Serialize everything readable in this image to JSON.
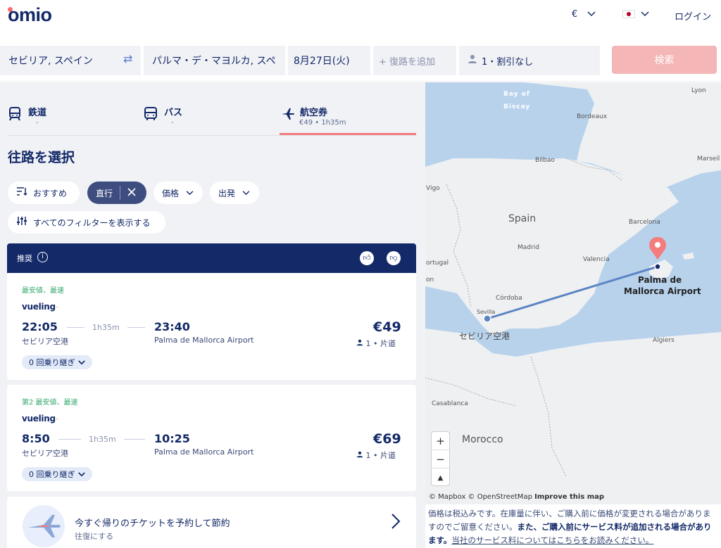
{
  "header": {
    "logo": "omio",
    "currency": "€",
    "login": "ログイン"
  },
  "search": {
    "from": "セビリア, スペイン",
    "to": "パルマ・デ・マヨルカ, スペ",
    "date": "8月27日(火)",
    "return_placeholder": "+ 復路を追加",
    "passengers": "1・割引なし",
    "submit": "検索"
  },
  "tabs": [
    {
      "icon": "train-icon",
      "label": "鉄道",
      "sub": "-"
    },
    {
      "icon": "bus-icon",
      "label": "バス",
      "sub": "-"
    },
    {
      "icon": "plane-icon",
      "label": "航空券",
      "sub": "€49 • 1h35m"
    }
  ],
  "page_title": "往路を選択",
  "filters": {
    "sort": "おすすめ",
    "direct": "直行",
    "price": "価格",
    "departure": "出発",
    "all_filters": "すべてのフィルターを表示する"
  },
  "recommended_label": "推奨",
  "results": [
    {
      "tag": "最安値、最速",
      "airline": "vueling",
      "dep_time": "22:05",
      "duration": "1h35m",
      "arr_time": "23:40",
      "dep_station": "セビリア空港",
      "arr_station": "Palma de Mallorca Airport",
      "price": "€49",
      "pax": "1 • 片道",
      "stops": "0 回乗り継ぎ"
    },
    {
      "tag": "第2 最安値、最速",
      "airline": "vueling",
      "dep_time": "8:50",
      "duration": "1h35m",
      "arr_time": "10:25",
      "dep_station": "セビリア空港",
      "arr_station": "Palma de Mallorca Airport",
      "price": "€69",
      "pax": "1 • 片道",
      "stops": "0 回乗り継ぎ"
    }
  ],
  "return_promo": {
    "title": "今すぐ帰りのチケットを予約して節約",
    "subtitle": "往復にする"
  },
  "map": {
    "labels": {
      "bay1": "Bay of",
      "bay2": "Biscay",
      "lyon": "Lyon",
      "bordeaux": "Bordeaux",
      "bilbao": "Bilbao",
      "marseille": "Marseil",
      "vigo": "Vigo",
      "spain": "Spain",
      "barcelona": "Barcelona",
      "madrid": "Madrid",
      "portugal": "ortugal",
      "valencia": "Valencia",
      "lisbon": "on",
      "cordoba": "Córdoba",
      "sevilla": "Sevilla",
      "algiers": "Algiers",
      "casablanca": "Casablanca",
      "morocco": "Morocco"
    },
    "origin_label": "セビリア空港",
    "dest_label_1": "Palma de",
    "dest_label_2": "Mallorca Airport",
    "attribution_1": "© Mapbox © OpenStreetMap",
    "attribution_2": "Improve this map",
    "zoom_in": "+",
    "zoom_out": "−",
    "compass": "▲"
  },
  "disclaimer": {
    "part1": "価格は税込みです。在庫量に伴い、ご購入前に価格が変更される場合があり",
    "part2": "ますのでご留意ください。",
    "bold": "また、ご購入前にサービス料が追加される場合が",
    "bold2": "あります。",
    "link": "当社のサービス料についてはこちらをお読みください。"
  },
  "colors": {
    "navy": "#132968",
    "accent": "#f47c7c",
    "search_btn": "#f4b6b6",
    "green_tag": "#34a86b",
    "route": "#5b84c4"
  }
}
